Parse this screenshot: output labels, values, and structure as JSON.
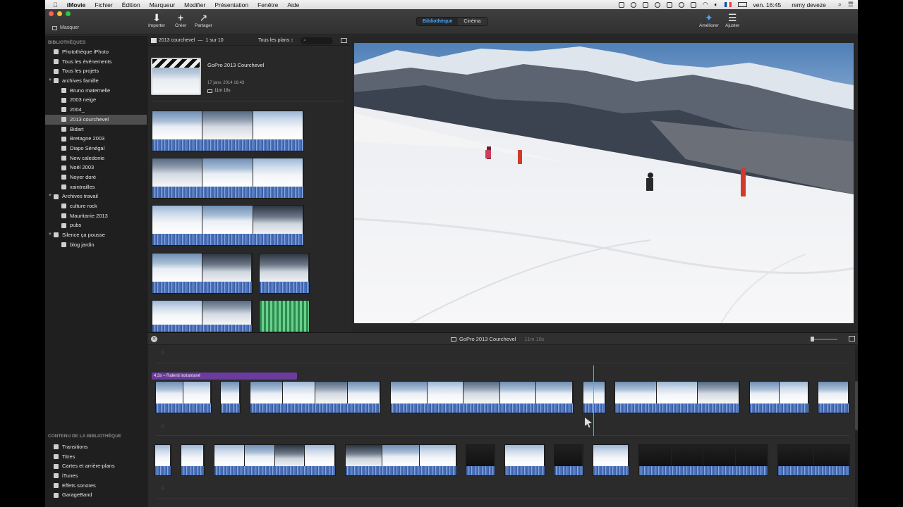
{
  "menubar": {
    "app": "iMovie",
    "menus": [
      "Fichier",
      "Édition",
      "Marqueur",
      "Modifier",
      "Présentation",
      "Fenêtre",
      "Aide"
    ],
    "clock": "ven. 16:45",
    "user": "remy deveze"
  },
  "toolbar": {
    "masquer": "Masquer",
    "importer": "Importer",
    "creer": "Créer",
    "partager": "Partager",
    "seg_library": "Bibliothèque",
    "seg_cinema": "Cinéma",
    "ameliorer": "Améliorer",
    "ajuster": "Ajuster",
    "colors": {
      "close": "#ff5f57",
      "min": "#febc2e",
      "max": "#28c840",
      "accent": "#4aa3ff"
    }
  },
  "sidebar": {
    "libraries_heading": "BIBLIOTHÈQUES",
    "items": [
      {
        "label": "Photothèque iPhoto",
        "level": 0
      },
      {
        "label": "Tous les événements",
        "level": 0
      },
      {
        "label": "Tous les projets",
        "level": 0
      },
      {
        "label": "archives famille",
        "level": 0
      },
      {
        "label": "Bruno maternelle",
        "level": 1
      },
      {
        "label": "2003 neige",
        "level": 1
      },
      {
        "label": "2004_",
        "level": 1
      },
      {
        "label": "2013 courchevel",
        "level": 1,
        "selected": true
      },
      {
        "label": "Bidart",
        "level": 1
      },
      {
        "label": "Bretagne 2003",
        "level": 1
      },
      {
        "label": "Diapo Sénégal",
        "level": 1
      },
      {
        "label": "New caledonie",
        "level": 1
      },
      {
        "label": "Noël 2003",
        "level": 1
      },
      {
        "label": "Noyer doré",
        "level": 1
      },
      {
        "label": "xaintrailles",
        "level": 1
      },
      {
        "label": "Archives travail",
        "level": 0
      },
      {
        "label": "culture rock",
        "level": 1
      },
      {
        "label": "Mauritanie 2013",
        "level": 1
      },
      {
        "label": "pubs",
        "level": 1
      },
      {
        "label": "Silence ça pousse",
        "level": 0
      },
      {
        "label": "blog jardin",
        "level": 1
      }
    ],
    "content_heading": "CONTENU DE LA BIBLIOTHÈQUE",
    "content_items": [
      "Transitions",
      "Titres",
      "Cartes et arrière-plans",
      "iTunes",
      "Effets sonores",
      "GarageBand"
    ]
  },
  "browser": {
    "event_title": "2013 courchevel",
    "count": "1 sur 10",
    "filter": "Tous les plans",
    "project": {
      "title": "GoPro 2013 Courchevel",
      "date": "17 janv. 2014 16:43",
      "duration": "11m 18s"
    }
  },
  "timeline": {
    "project_title": "GoPro 2013 Courchevel",
    "duration": "11m 18s",
    "title_clip": "4,3s – Ralenti instantané"
  }
}
